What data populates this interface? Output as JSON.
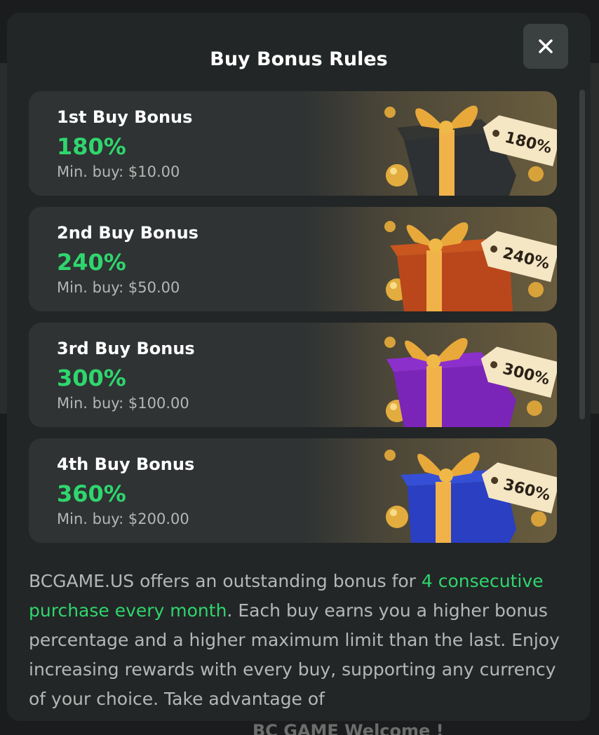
{
  "modal": {
    "title": "Buy Bonus Rules",
    "close_icon": "close-icon"
  },
  "cards": [
    {
      "title": "1st Buy Bonus",
      "percent": "180%",
      "min_buy": "Min. buy: $10.00",
      "tag": "180%",
      "box_color": "#2e3133"
    },
    {
      "title": "2nd Buy Bonus",
      "percent": "240%",
      "min_buy": "Min. buy: $50.00",
      "tag": "240%",
      "box_color": "#b9471b"
    },
    {
      "title": "3rd Buy Bonus",
      "percent": "300%",
      "min_buy": "Min. buy: $100.00",
      "tag": "300%",
      "box_color": "#7a25b8"
    },
    {
      "title": "4th Buy Bonus",
      "percent": "360%",
      "min_buy": "Min. buy: $200.00",
      "tag": "360%",
      "box_color": "#2a3fc2"
    }
  ],
  "description": {
    "part1": "BCGAME.US offers an outstanding bonus for ",
    "highlight": "4 consecutive purchase every month",
    "part2": ". Each buy earns you a higher bonus percentage and a higher maximum limit than the last. Enjoy increasing rewards with every buy, supporting any currency of your choice. Take advantage of"
  },
  "background": {
    "bottom_text": "BC GAME Welcome !"
  },
  "colors": {
    "accent_green": "#2fd66e",
    "modal_bg": "#232626",
    "card_bg": "#2f3333",
    "gold": "#e0a93a"
  }
}
